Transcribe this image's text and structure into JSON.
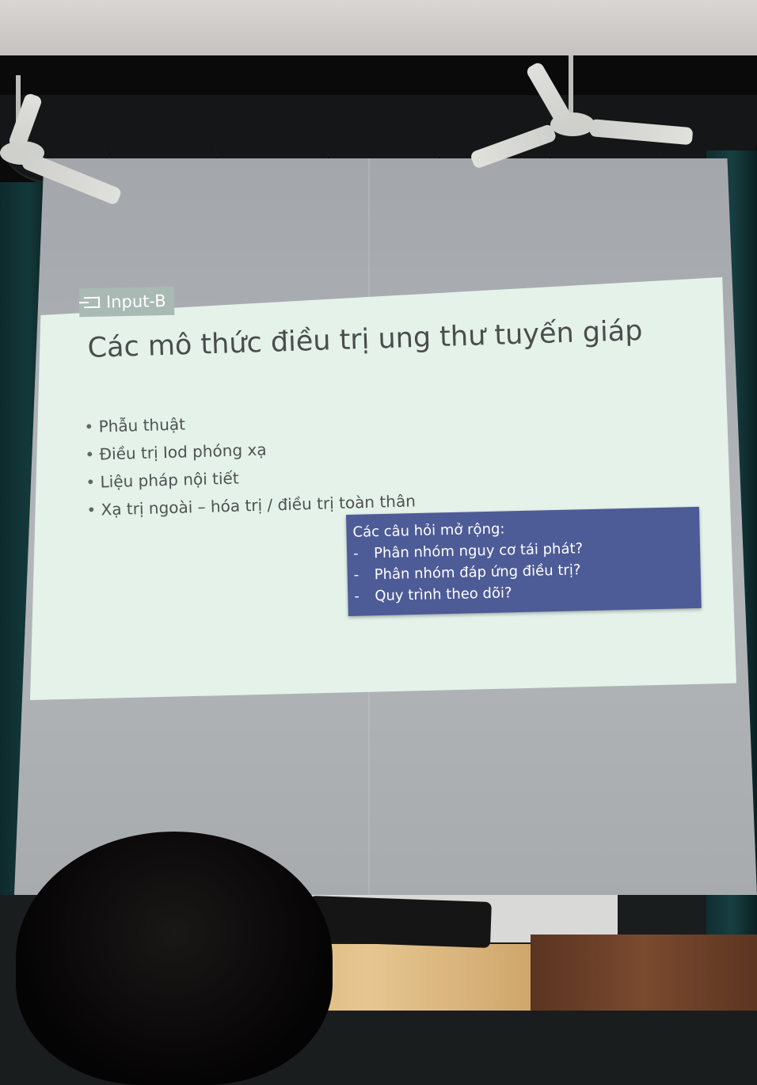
{
  "slide": {
    "input_source": "Input-B",
    "title": "Các mô thức điều trị ung thư tuyến giáp",
    "bullets": [
      "Phẫu thuật",
      "Điều trị Iod phóng xạ",
      "Liệu pháp nội tiết",
      "Xạ trị ngoài – hóa trị / điều trị toàn thân"
    ],
    "question_box": {
      "heading": "Các câu hỏi mở rộng:",
      "items": [
        "Phân nhóm nguy cơ tái phát?",
        "Phân nhóm đáp ứng điều trị?",
        "Quy trình theo dõi?"
      ],
      "background_color": "#4d5b97"
    },
    "background_color": "#e4f2ea"
  },
  "scene": {
    "icons": [
      "ceiling-fan-icon",
      "input-source-icon"
    ]
  }
}
